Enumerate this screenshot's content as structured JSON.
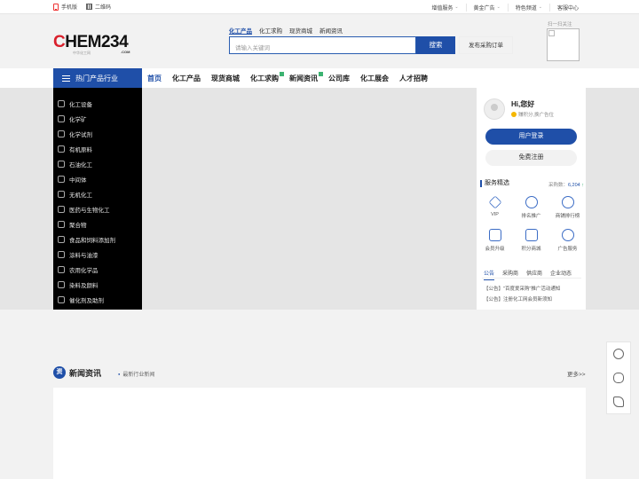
{
  "topbar": {
    "mobile_label": "手机版",
    "qr_label": "二维码",
    "right_items": [
      {
        "label": "增值服务",
        "caret": true
      },
      {
        "label": "黄金广告",
        "caret": true
      },
      {
        "label": "特色频道",
        "caret": true
      },
      {
        "label": "客服中心",
        "caret": false
      }
    ]
  },
  "logo": {
    "main_prefix": "C",
    "main_rest": "HEM234",
    "sub": "中华化工网",
    "com": ".COM"
  },
  "search": {
    "tabs": [
      "化工产品",
      "化工求购",
      "现货商城",
      "新闻资讯"
    ],
    "active_tab": 0,
    "placeholder": "请输入关键词",
    "search_button": "搜索",
    "publish_button": "发布采购订单",
    "qr_label": "扫一扫关注"
  },
  "nav": {
    "hot_label": "热门产品行业",
    "items": [
      {
        "label": "首页",
        "active": true,
        "badge": false
      },
      {
        "label": "化工产品",
        "active": false,
        "badge": false
      },
      {
        "label": "现货商城",
        "active": false,
        "badge": false
      },
      {
        "label": "化工求购",
        "active": false,
        "badge": true
      },
      {
        "label": "新闻资讯",
        "active": false,
        "badge": true
      },
      {
        "label": "公司库",
        "active": false,
        "badge": false
      },
      {
        "label": "化工展会",
        "active": false,
        "badge": false
      },
      {
        "label": "人才招聘",
        "active": false,
        "badge": false
      }
    ]
  },
  "categories": [
    "化工设备",
    "化学矿",
    "化学试剂",
    "有机原料",
    "石油化工",
    "中间体",
    "无机化工",
    "医药与生物化工",
    "聚合物",
    "食品和饲料添加剂",
    "涂料与油漆",
    "农用化学品",
    "染料及颜料",
    "催化剂及助剂"
  ],
  "user": {
    "greeting": "Hi,您好",
    "points_text": "赚积分,换广告位",
    "login_button": "用户登录",
    "register_button": "免费注册"
  },
  "services": {
    "title": "服务精选",
    "count_label": "采购数：",
    "count_value": "6,204",
    "count_arrow": "↑",
    "items": [
      "VIP",
      "排名推广",
      "商铺排行榜",
      "会员升级",
      "积分商城",
      "广告服务"
    ]
  },
  "notice": {
    "tabs": [
      "公告",
      "采购商",
      "供应商",
      "企业动态"
    ],
    "active_tab": 0,
    "items": [
      "【公告】\"百度爱采购\"推广活动通知",
      "【公告】注册化工网会员新须知"
    ]
  },
  "news": {
    "icon_label": "资",
    "title": "新闻资讯",
    "subtitle": "最新行业新闻",
    "more": "更多>>"
  },
  "floatbar": [
    "headset-icon",
    "wechat-icon",
    "phone-icon"
  ]
}
